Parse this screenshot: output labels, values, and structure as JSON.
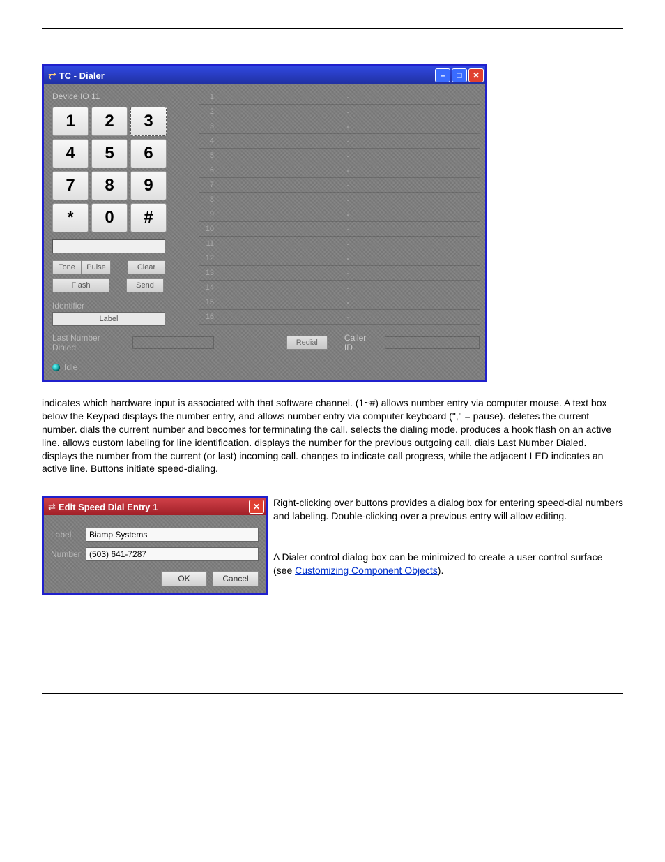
{
  "dialer": {
    "title": "TC - Dialer",
    "device_io": "Device IO  11",
    "keys": [
      "1",
      "2",
      "3",
      "4",
      "5",
      "6",
      "7",
      "8",
      "9",
      "*",
      "0",
      "#"
    ],
    "selected_key_index": 2,
    "numbox_value": "",
    "tone": "Tone",
    "pulse": "Pulse",
    "clear": "Clear",
    "flash": "Flash",
    "send": "Send",
    "identifier": "Identifier",
    "label_field": "Label",
    "speed_rows": [
      "1",
      "2",
      "3",
      "4",
      "5",
      "6",
      "7",
      "8",
      "9",
      "10",
      "11",
      "12",
      "13",
      "14",
      "15",
      "16"
    ],
    "lnd": "Last Number Dialed",
    "redial": "Redial",
    "caller_id": "Caller ID",
    "status": "Idle"
  },
  "edit": {
    "title": "Edit Speed Dial Entry 1",
    "label_lab": "Label",
    "label_val": "Biamp Systems",
    "number_lab": "Number",
    "number_val": "(503) 641-7287",
    "ok": "OK",
    "cancel": "Cancel"
  },
  "p1": {
    "t1": " indicates which hardware input is associated with that software channel. ",
    "t2": " (1~#) allows number entry via computer mouse. A text box below the Keypad displays the number entry, and allows number entry via computer keyboard (\",\" = pause). ",
    "t3": " deletes the current number. ",
    "t4": " dials the current number and becomes ",
    "t5": " for terminating the call. ",
    "t6": " selects the dialing mode. ",
    "t7": " produces a hook flash on an active line. ",
    "t8": " allows custom labeling for line identification. ",
    "t9": " displays the number for the previous outgoing call. ",
    "t10": " dials Last Number Dialed. ",
    "t11": " displays the number from the current (or last) incoming call. ",
    "t12": " changes to indicate call progress, while the adjacent LED indicates an active line. Buttons ",
    "t13": " initiate speed-dialing."
  },
  "p2": {
    "a": "Right-clicking over buttons ",
    "b": " provides a dialog box for entering speed-dial numbers and labeling. Double-clicking over a previous entry will allow editing."
  },
  "p3": {
    "a": "A Dialer control dialog box can be minimized to create a user control surface (see ",
    "link": "Customizing Component Objects",
    "b": ")."
  }
}
